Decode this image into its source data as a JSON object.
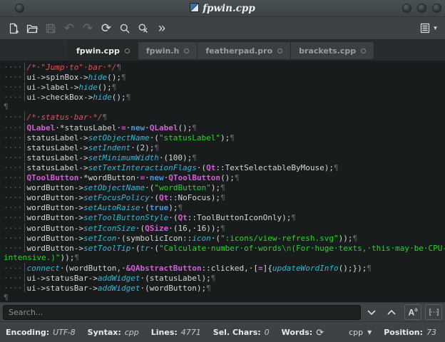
{
  "window": {
    "title": "fpwin.cpp",
    "app_icon": "featherpad-logo-icon",
    "controls": [
      "window-menu-button",
      "minimize-button",
      "maximize-button",
      "close-button"
    ]
  },
  "toolbar": {
    "buttons": [
      {
        "name": "new-file",
        "icon": "new-file-icon",
        "enabled": true
      },
      {
        "name": "open-file",
        "icon": "open-folder-icon",
        "enabled": true
      },
      {
        "name": "save",
        "icon": "save-icon",
        "enabled": false
      },
      {
        "name": "undo",
        "icon": "undo-icon",
        "enabled": false
      },
      {
        "name": "redo",
        "icon": "redo-icon",
        "enabled": false
      },
      {
        "name": "reload",
        "icon": "reload-icon",
        "enabled": true
      },
      {
        "name": "find",
        "icon": "search-icon",
        "enabled": true
      },
      {
        "name": "hide-search",
        "icon": "search-close-icon",
        "enabled": true
      },
      {
        "name": "more-toolbuttons",
        "icon": "double-chevron-icon",
        "enabled": true
      },
      {
        "name": "menu",
        "icon": "menu-list-icon",
        "enabled": true
      }
    ],
    "undo_glyph": "↶",
    "redo_glyph": "↷",
    "reload_glyph": "⟳",
    "more_glyph": "»",
    "menu_caret": "▼"
  },
  "tabs": [
    {
      "label": "fpwin.cpp",
      "active": true
    },
    {
      "label": "fpwin.h",
      "active": false
    },
    {
      "label": "featherpad.pro",
      "active": false
    },
    {
      "label": "brackets.cpp",
      "active": false
    }
  ],
  "editor": {
    "lines": [
      {
        "indent": true,
        "segs": [
          [
            "ws",
            "····"
          ],
          [
            "cm",
            "/*·\"Jump·to\"·bar·*/"
          ],
          [
            "ws",
            "¶"
          ]
        ]
      },
      {
        "indent": true,
        "segs": [
          [
            "ws",
            "····"
          ],
          [
            "t",
            "ui->spinBox->"
          ],
          [
            "fn",
            "hide"
          ],
          [
            "t",
            "();"
          ],
          [
            "ws",
            "¶"
          ]
        ]
      },
      {
        "indent": true,
        "segs": [
          [
            "ws",
            "····"
          ],
          [
            "t",
            "ui->label->"
          ],
          [
            "fn",
            "hide"
          ],
          [
            "t",
            "();"
          ],
          [
            "ws",
            "¶"
          ]
        ]
      },
      {
        "indent": true,
        "segs": [
          [
            "ws",
            "····"
          ],
          [
            "t",
            "ui->checkBox->"
          ],
          [
            "fn",
            "hide"
          ],
          [
            "t",
            "();"
          ],
          [
            "ws",
            "¶"
          ]
        ]
      },
      {
        "indent": false,
        "segs": [
          [
            "ws",
            "¶"
          ]
        ]
      },
      {
        "indent": true,
        "segs": [
          [
            "ws",
            "····"
          ],
          [
            "cm",
            "/*·status·bar·*/"
          ],
          [
            "ws",
            "¶"
          ]
        ]
      },
      {
        "indent": true,
        "segs": [
          [
            "ws",
            "····"
          ],
          [
            "cls",
            "QLabel"
          ],
          [
            "t",
            "·*statusLabel·"
          ],
          [
            "op",
            "="
          ],
          [
            "t",
            "·"
          ],
          [
            "kw",
            "new"
          ],
          [
            "t",
            "·"
          ],
          [
            "cls",
            "QLabel"
          ],
          [
            "t",
            "();"
          ],
          [
            "ws",
            "¶"
          ]
        ]
      },
      {
        "indent": true,
        "segs": [
          [
            "ws",
            "····"
          ],
          [
            "t",
            "statusLabel->"
          ],
          [
            "fn",
            "setObjectName"
          ],
          [
            "t",
            "·("
          ],
          [
            "str",
            "\"statusLabel\""
          ],
          [
            "t",
            ");"
          ],
          [
            "ws",
            "¶"
          ]
        ]
      },
      {
        "indent": true,
        "segs": [
          [
            "ws",
            "····"
          ],
          [
            "t",
            "statusLabel->"
          ],
          [
            "fn",
            "setIndent"
          ],
          [
            "t",
            "·(2);"
          ],
          [
            "ws",
            "¶"
          ]
        ]
      },
      {
        "indent": true,
        "segs": [
          [
            "ws",
            "····"
          ],
          [
            "t",
            "statusLabel->"
          ],
          [
            "fn",
            "setMinimumWidth"
          ],
          [
            "t",
            "·(100);"
          ],
          [
            "ws",
            "¶"
          ]
        ]
      },
      {
        "indent": true,
        "segs": [
          [
            "ws",
            "····"
          ],
          [
            "t",
            "statusLabel->"
          ],
          [
            "fn",
            "setTextInteractionFlags"
          ],
          [
            "t",
            "·("
          ],
          [
            "cls",
            "Qt"
          ],
          [
            "t",
            "::TextSelectableByMouse);"
          ],
          [
            "ws",
            "¶"
          ]
        ]
      },
      {
        "indent": true,
        "segs": [
          [
            "ws",
            "····"
          ],
          [
            "cls",
            "QToolButton"
          ],
          [
            "t",
            "·*wordButton·"
          ],
          [
            "op",
            "="
          ],
          [
            "t",
            "·"
          ],
          [
            "kw",
            "new"
          ],
          [
            "t",
            "·"
          ],
          [
            "cls",
            "QToolButton"
          ],
          [
            "t",
            "();"
          ],
          [
            "ws",
            "¶"
          ]
        ]
      },
      {
        "indent": true,
        "segs": [
          [
            "ws",
            "····"
          ],
          [
            "t",
            "wordButton->"
          ],
          [
            "fn",
            "setObjectName"
          ],
          [
            "t",
            "·("
          ],
          [
            "str",
            "\"wordButton\""
          ],
          [
            "t",
            ");"
          ],
          [
            "ws",
            "¶"
          ]
        ]
      },
      {
        "indent": true,
        "segs": [
          [
            "ws",
            "····"
          ],
          [
            "t",
            "wordButton->"
          ],
          [
            "fn",
            "setFocusPolicy"
          ],
          [
            "t",
            "·("
          ],
          [
            "cls",
            "Qt"
          ],
          [
            "t",
            "::NoFocus);"
          ],
          [
            "ws",
            "¶"
          ]
        ]
      },
      {
        "indent": true,
        "segs": [
          [
            "ws",
            "····"
          ],
          [
            "t",
            "wordButton->"
          ],
          [
            "fn",
            "setAutoRaise"
          ],
          [
            "t",
            "·("
          ],
          [
            "kw",
            "true"
          ],
          [
            "t",
            ");"
          ],
          [
            "ws",
            "¶"
          ]
        ]
      },
      {
        "indent": true,
        "segs": [
          [
            "ws",
            "····"
          ],
          [
            "t",
            "wordButton->"
          ],
          [
            "fn",
            "setToolButtonStyle"
          ],
          [
            "t",
            "·("
          ],
          [
            "cls",
            "Qt"
          ],
          [
            "t",
            "::ToolButtonIconOnly);"
          ],
          [
            "ws",
            "¶"
          ]
        ]
      },
      {
        "indent": true,
        "segs": [
          [
            "ws",
            "····"
          ],
          [
            "t",
            "wordButton->"
          ],
          [
            "fn",
            "setIconSize"
          ],
          [
            "t",
            "·("
          ],
          [
            "cls",
            "QSize"
          ],
          [
            "t",
            "·(16,·16));"
          ],
          [
            "ws",
            "¶"
          ]
        ]
      },
      {
        "indent": true,
        "segs": [
          [
            "ws",
            "····"
          ],
          [
            "t",
            "wordButton->"
          ],
          [
            "fn",
            "setIcon"
          ],
          [
            "t",
            "·(symbolicIcon::"
          ],
          [
            "fn",
            "icon"
          ],
          [
            "t",
            "·("
          ],
          [
            "str",
            "\":icons/view-refresh.svg\""
          ],
          [
            "t",
            "));"
          ],
          [
            "ws",
            "¶"
          ]
        ]
      },
      {
        "indent": true,
        "segs": [
          [
            "ws",
            "····"
          ],
          [
            "t",
            "wordButton->"
          ],
          [
            "fn",
            "setToolTip"
          ],
          [
            "t",
            "·("
          ],
          [
            "fn",
            "tr"
          ],
          [
            "t",
            "·("
          ],
          [
            "str",
            "\"Calculate·number·of·words"
          ],
          [
            "esc",
            "\\n"
          ],
          [
            "str",
            "(For·huge·texts,·this·may·be·CPU-"
          ]
        ]
      },
      {
        "indent": false,
        "segs": [
          [
            "str",
            "intensive.)\""
          ],
          [
            "t",
            "));"
          ],
          [
            "ws",
            "¶"
          ]
        ]
      },
      {
        "indent": true,
        "segs": [
          [
            "ws",
            "····"
          ],
          [
            "fn",
            "connect"
          ],
          [
            "t",
            "·(wordButton,·"
          ],
          [
            "cls",
            "&QAbstractButton"
          ],
          [
            "t",
            "::clicked,·["
          ],
          [
            "op",
            "="
          ],
          [
            "t",
            "]{"
          ],
          [
            "fn",
            "updateWordInfo"
          ],
          [
            "t",
            "();});"
          ],
          [
            "ws",
            "¶"
          ]
        ]
      },
      {
        "indent": true,
        "segs": [
          [
            "ws",
            "····"
          ],
          [
            "t",
            "ui->statusBar->"
          ],
          [
            "fn",
            "addWidget"
          ],
          [
            "t",
            "·(statusLabel);"
          ],
          [
            "ws",
            "¶"
          ]
        ]
      },
      {
        "indent": true,
        "segs": [
          [
            "ws",
            "····"
          ],
          [
            "t",
            "ui->statusBar->"
          ],
          [
            "fn",
            "addWidget"
          ],
          [
            "t",
            "·(wordButton);"
          ],
          [
            "ws",
            "¶"
          ]
        ]
      },
      {
        "indent": false,
        "segs": [
          [
            "ws",
            "¶"
          ]
        ]
      }
    ]
  },
  "search": {
    "placeholder": "Search...",
    "value": "",
    "buttons": [
      "find-next-icon",
      "find-previous-icon",
      "match-case-icon",
      "whole-word-icon"
    ],
    "match_case_main": "A",
    "match_case_sup": "a",
    "whole_word_text": "[⋯]"
  },
  "statusbar": {
    "encoding_label": "Encoding:",
    "encoding_value": "UTF-8",
    "syntax_label": "Syntax:",
    "syntax_value": "cpp",
    "lines_label": "Lines:",
    "lines_value": "4771",
    "sel_label": "Sel. Chars:",
    "sel_value": "0",
    "words_label": "Words:",
    "words_refresh_icon": "refresh-icon",
    "refresh_glyph": "⟳",
    "syntax_combo_value": "cpp",
    "combo_caret": "▼",
    "position_label": "Position:",
    "position_value": "73"
  },
  "colors": {
    "chrome": "#3d4345",
    "code_bg": "#191c1d",
    "tabstrip_bg": "#282c2e",
    "comment_red": "#e05454",
    "string_green": "#2ed22e",
    "function_cyan": "#35b6d0",
    "keyword_blue": "#4b96dc",
    "class_magenta": "#d25fd2",
    "whitespace_gray": "#595f62"
  }
}
